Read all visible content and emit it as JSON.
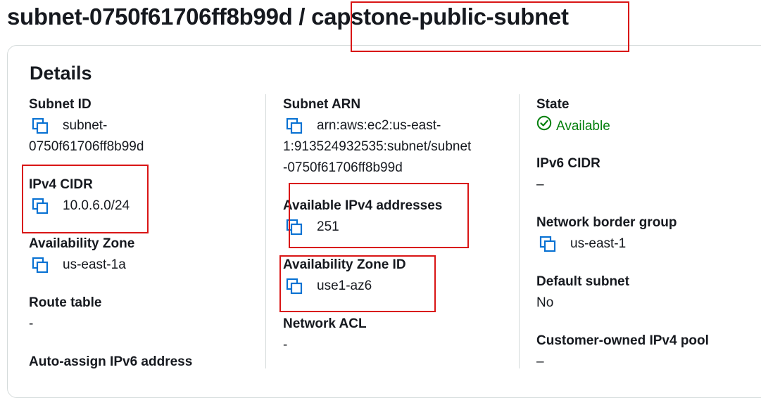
{
  "header": {
    "subnet_id": "subnet-0750f61706ff8b99d",
    "separator": " / ",
    "subnet_name": "capstone-public-subnet"
  },
  "details": {
    "heading": "Details",
    "col1": {
      "subnet_id_label": "Subnet ID",
      "subnet_id_line1": "subnet-",
      "subnet_id_line2": "0750f61706ff8b99d",
      "ipv4_cidr_label": "IPv4 CIDR",
      "ipv4_cidr_value": "10.0.6.0/24",
      "az_label": "Availability Zone",
      "az_value": "us-east-1a",
      "route_table_label": "Route table",
      "route_table_value": "-",
      "auto_ipv6_label": "Auto-assign IPv6 address"
    },
    "col2": {
      "arn_label": "Subnet ARN",
      "arn_line1": "arn:aws:ec2:us-east-",
      "arn_line2": "1:913524932535:subnet/subnet",
      "arn_line3": "-0750f61706ff8b99d",
      "avail_ipv4_label": "Available IPv4 addresses",
      "avail_ipv4_value": "251",
      "az_id_label": "Availability Zone ID",
      "az_id_value": "use1-az6",
      "nacl_label": "Network ACL",
      "nacl_value": "-"
    },
    "col3": {
      "state_label": "State",
      "state_value": "Available",
      "ipv6_cidr_label": "IPv6 CIDR",
      "ipv6_cidr_value": "–",
      "nbg_label": "Network border group",
      "nbg_value": "us-east-1",
      "default_subnet_label": "Default subnet",
      "default_subnet_value": "No",
      "coip_label": "Customer-owned IPv4 pool",
      "coip_value": "–"
    }
  },
  "colors": {
    "accent": "#0972d3",
    "success": "#037f0c",
    "highlight": "#d91515"
  },
  "icons": {
    "copy": "copy-icon",
    "status": "status-check-icon"
  }
}
